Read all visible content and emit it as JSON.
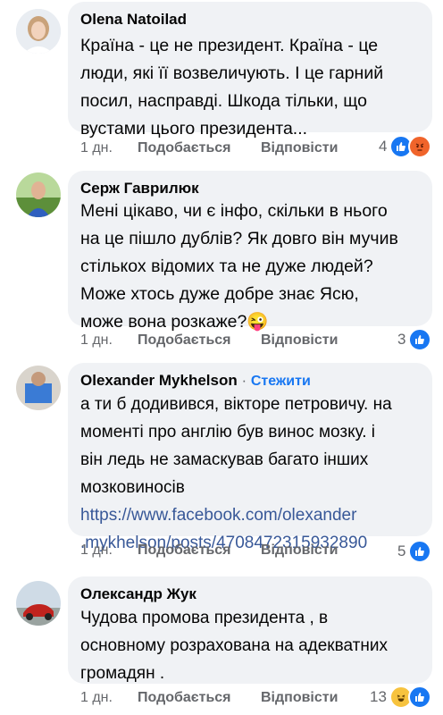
{
  "comments": [
    {
      "author": "Olena Natoilad",
      "lines": [
        "Країна - це не президент. Країна - це",
        "люди, які її возвеличують.  І це гарний",
        "посил, насправді. Шкода тільки, що",
        "вустами цього президента..."
      ],
      "time": "1 дн.",
      "like_label": "Подобається",
      "reply_label": "Відповісти",
      "reaction_count": "4",
      "reactions": [
        "like-icon",
        "angry-icon"
      ]
    },
    {
      "author": "Серж Гаврилюк",
      "lines": [
        "Мені цікаво, чи є інфо, скільки в нього",
        "на це пішло дублів? Як довго він мучив",
        "стількох відомих та не дуже людей?",
        "Може хтось дуже добре знає Ясю,",
        "може вона розкаже?"
      ],
      "emoji": "😜",
      "time": "1 дн.",
      "like_label": "Подобається",
      "reply_label": "Відповісти",
      "reaction_count": "3",
      "reactions": [
        "like-icon"
      ]
    },
    {
      "author": "Olexander  Mykhelson",
      "follow_sep": " · ",
      "follow_label": "Стежити",
      "lines": [
        "а ти б додивився, вікторе петровичу. на",
        "моменті про англію був винос мозку. і",
        "він ледь не замаскував багато інших",
        "мозковиносів"
      ],
      "link_lines": [
        "https://www.facebook.com/olexander",
        ".mykhelson/posts/4708472315932890"
      ],
      "time": "1 дн.",
      "like_label": "Подобається",
      "reply_label": "Відповісти",
      "reaction_count": "5",
      "reactions": [
        "like-icon"
      ]
    },
    {
      "author": "Олександр Жук",
      "lines": [
        "Чудова промова президента , в",
        "основному розрахована на адекватних",
        "громадян ."
      ],
      "time": "1 дн.",
      "like_label": "Подобається",
      "reply_label": "Відповісти",
      "reaction_count": "13",
      "reactions": [
        "haha-icon",
        "like-icon"
      ]
    }
  ],
  "colors": {
    "bubble": "#f0f2f5",
    "meta": "#65676b",
    "link": "#385898",
    "follow": "#1877f2",
    "like": "#1877f2",
    "angry": "#f0642b",
    "haha": "#f7c33e"
  }
}
